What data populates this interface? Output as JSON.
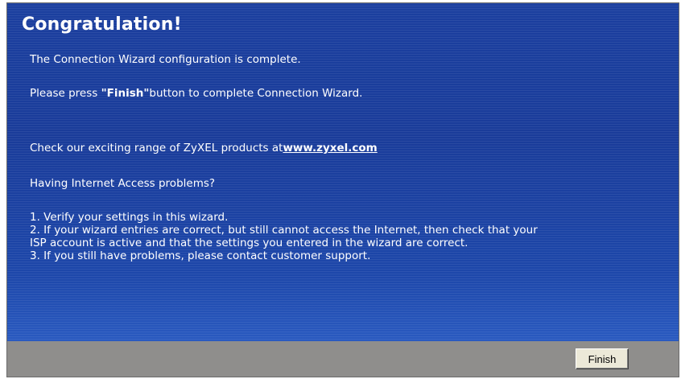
{
  "title": "Congratulation!",
  "messages": {
    "complete": "The Connection Wizard configuration is complete.",
    "press_prefix": "Please press ",
    "press_bold": "\"Finish\"",
    "press_suffix": "button to complete Connection Wizard.",
    "check_prefix": "Check our exciting range of ZyXEL products at",
    "check_link": "www.zyxel.com",
    "problems_heading": "Having Internet Access problems?",
    "steps": [
      "1. Verify your settings in this wizard.",
      "2. If your wizard entries are correct, but still cannot access the Internet, then check that your",
      "ISP account is active and that the settings you entered in the wizard are correct.",
      "3. If you still have problems, please contact customer support."
    ]
  },
  "footer": {
    "finish_label": "Finish"
  },
  "colors": {
    "panel_blue": "#1c3fa0",
    "footer_gray": "#8f8e8c",
    "text": "#ffffff"
  }
}
